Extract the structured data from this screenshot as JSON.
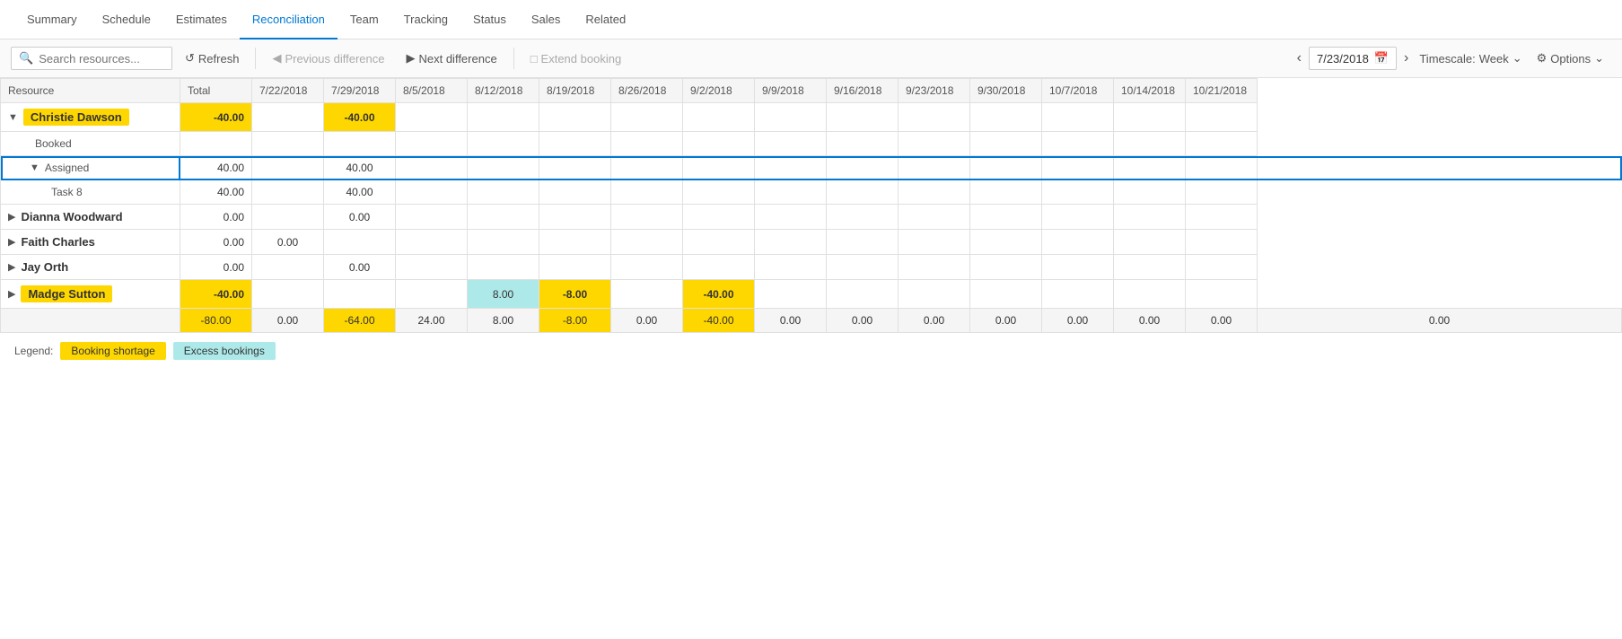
{
  "nav": {
    "items": [
      {
        "id": "summary",
        "label": "Summary",
        "active": false
      },
      {
        "id": "schedule",
        "label": "Schedule",
        "active": false
      },
      {
        "id": "estimates",
        "label": "Estimates",
        "active": false
      },
      {
        "id": "reconciliation",
        "label": "Reconciliation",
        "active": true
      },
      {
        "id": "team",
        "label": "Team",
        "active": false
      },
      {
        "id": "tracking",
        "label": "Tracking",
        "active": false
      },
      {
        "id": "status",
        "label": "Status",
        "active": false
      },
      {
        "id": "sales",
        "label": "Sales",
        "active": false
      },
      {
        "id": "related",
        "label": "Related",
        "active": false
      }
    ]
  },
  "toolbar": {
    "search_placeholder": "Search resources...",
    "refresh_label": "Refresh",
    "prev_diff_label": "Previous difference",
    "next_diff_label": "Next difference",
    "extend_booking_label": "Extend booking",
    "date_value": "7/23/2018",
    "timescale_label": "Timescale:",
    "timescale_value": "Week",
    "options_label": "Options"
  },
  "grid": {
    "headers": {
      "resource": "Resource",
      "total": "Total",
      "dates": [
        "7/22/2018",
        "7/29/2018",
        "8/5/2018",
        "8/12/2018",
        "8/19/2018",
        "8/26/2018",
        "9/2/2018",
        "9/9/2018",
        "9/16/2018",
        "9/23/2018",
        "9/30/2018",
        "10/7/2018",
        "10/14/2018",
        "10/21/2018"
      ]
    },
    "rows": [
      {
        "type": "resource",
        "name": "Christie Dawson",
        "highlighted": true,
        "expanded": true,
        "total": "-40.00",
        "values": [
          "",
          "-40.00",
          "",
          "",
          "",
          "",
          "",
          "",
          "",
          "",
          "",
          "",
          "",
          ""
        ]
      },
      {
        "type": "sub",
        "name": "Booked",
        "indent": 1,
        "total": "",
        "values": [
          "",
          "",
          "",
          "",
          "",
          "",
          "",
          "",
          "",
          "",
          "",
          "",
          "",
          ""
        ]
      },
      {
        "type": "sub",
        "name": "Assigned",
        "indent": 1,
        "expanded": true,
        "selected": true,
        "total": "40.00",
        "values": [
          "",
          "40.00",
          "",
          "",
          "",
          "",
          "",
          "",
          "",
          "",
          "",
          "",
          "",
          ""
        ]
      },
      {
        "type": "task",
        "name": "Task 8",
        "indent": 2,
        "total": "40.00",
        "values": [
          "",
          "40.00",
          "",
          "",
          "",
          "",
          "",
          "",
          "",
          "",
          "",
          "",
          "",
          ""
        ]
      },
      {
        "type": "resource",
        "name": "Dianna Woodward",
        "highlighted": false,
        "expanded": false,
        "total": "0.00",
        "values": [
          "",
          "0.00",
          "",
          "",
          "",
          "",
          "",
          "",
          "",
          "",
          "",
          "",
          "",
          ""
        ]
      },
      {
        "type": "resource",
        "name": "Faith Charles",
        "highlighted": false,
        "expanded": false,
        "total": "0.00",
        "values": [
          "0.00",
          "",
          "",
          "",
          "",
          "",
          "",
          "",
          "",
          "",
          "",
          "",
          "",
          ""
        ]
      },
      {
        "type": "resource",
        "name": "Jay Orth",
        "highlighted": false,
        "expanded": false,
        "total": "0.00",
        "values": [
          "",
          "0.00",
          "",
          "",
          "",
          "",
          "",
          "",
          "",
          "",
          "",
          "",
          "",
          ""
        ]
      },
      {
        "type": "resource",
        "name": "Madge Sutton",
        "highlighted": true,
        "negative": true,
        "expanded": false,
        "total": "-40.00",
        "values": [
          "",
          "",
          "",
          "8.00",
          "-8.00",
          "",
          "-40.00",
          "",
          "",
          "",
          "",
          "",
          "",
          ""
        ]
      }
    ],
    "totals_row": {
      "label": "",
      "total": "-80.00",
      "values": [
        "0.00",
        "-64.00",
        "24.00",
        "8.00",
        "-8.00",
        "0.00",
        "-40.00",
        "0.00",
        "0.00",
        "0.00",
        "0.00",
        "0.00",
        "0.00",
        "0.00"
      ]
    }
  },
  "legend": {
    "label": "Legend:",
    "shortage_label": "Booking shortage",
    "excess_label": "Excess bookings"
  },
  "colors": {
    "yellow": "#ffd700",
    "cyan": "#aee9e9",
    "blue_accent": "#0078d4"
  }
}
